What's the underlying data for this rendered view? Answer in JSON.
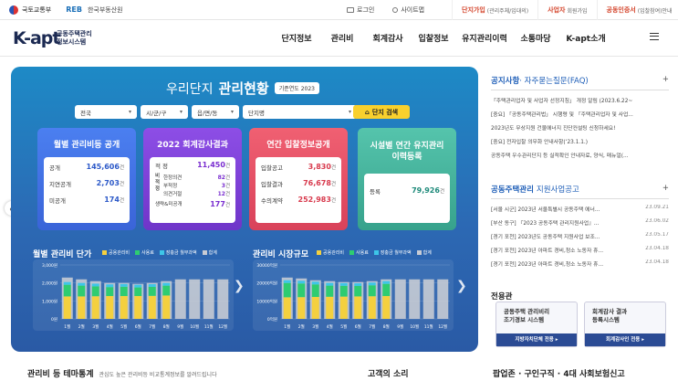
{
  "topbar": {
    "ministry": "국토교통부",
    "reb_logo": "REB",
    "reb_name": "한국부동산원",
    "login": "로그인",
    "sitemap": "사이트맵",
    "join_complex": "단지가입",
    "join_complex_sub": "(관리주체/입대의)",
    "join_business": "사업자",
    "join_business_sub": "회원가입",
    "cert": "공동인증서",
    "cert_sub": "(입찰참여)안내"
  },
  "nav": {
    "logo": "K-apt",
    "logo_sub_1": "공동주택관리",
    "logo_sub_2": "정보시스템",
    "items": [
      "단지정보",
      "관리비",
      "회계감사",
      "입찰정보",
      "유지관리이력",
      "소통마당",
      "K-apt소개"
    ]
  },
  "panel": {
    "title_light": "우리단지",
    "title_bold": "관리현황",
    "year_label": "기준연도 2023",
    "filters": [
      "전국",
      "시/군/구",
      "읍/면/동",
      "단지명"
    ],
    "search_button": "단지 검색",
    "cards": [
      {
        "title": "월별 관리비등 공개",
        "rows": [
          [
            "공개",
            "145,606",
            "건"
          ],
          [
            "지연공개",
            "2,703",
            "건"
          ],
          [
            "미공개",
            "174",
            "건"
          ]
        ]
      },
      {
        "title": "2022 회계감사결과",
        "rows": [
          [
            "적 정",
            "11,450",
            "건"
          ],
          [
            "한정의견",
            "82",
            "건"
          ],
          [
            "부적정",
            "3",
            "건"
          ],
          [
            "의견거절",
            "12",
            "건"
          ],
          [
            "생략&미공개",
            "177",
            "건"
          ]
        ],
        "side_label": "비적정"
      },
      {
        "title": "연간 입찰정보공개",
        "rows": [
          [
            "입찰공고",
            "3,830",
            "건"
          ],
          [
            "입찰결과",
            "76,678",
            "건"
          ],
          [
            "수의계약",
            "252,983",
            "건"
          ]
        ]
      },
      {
        "title": "시설별 연간 유지관리 이력등록",
        "rows": [
          [
            "등록",
            "79,926",
            "건"
          ]
        ]
      }
    ],
    "chart1_title": "월별 관리비 단가",
    "chart2_title": "관리비 시장규모",
    "legend": [
      "공용관리비",
      "사용료",
      "장충금 월부과액",
      "합계"
    ],
    "legend_colors": [
      "#f4d03f",
      "#2ecc71",
      "#3dc6e8",
      "#c7cbd4"
    ]
  },
  "chart_data": [
    {
      "type": "bar",
      "title": "월별 관리비 단가",
      "ylabel": "",
      "categories": [
        "1월",
        "2월",
        "3월",
        "4월",
        "5월",
        "6월",
        "7월",
        "8월",
        "9월",
        "10월",
        "11월",
        "12월"
      ],
      "y_ticks": [
        "3,000원",
        "2,000원",
        "1,000원",
        "0원"
      ],
      "ylim": [
        0,
        3000
      ],
      "series": [
        {
          "name": "공용관리비",
          "values": [
            1250,
            1250,
            1260,
            1270,
            1270,
            1270,
            1280,
            1300,
            0,
            0,
            0,
            0
          ]
        },
        {
          "name": "사용료",
          "values": [
            650,
            600,
            550,
            500,
            520,
            480,
            500,
            550,
            0,
            0,
            0,
            0
          ]
        },
        {
          "name": "장충금 월부과액",
          "values": [
            150,
            150,
            150,
            150,
            150,
            150,
            150,
            150,
            0,
            0,
            0,
            0
          ]
        },
        {
          "name": "합계",
          "values": [
            2300,
            2200,
            2100,
            2000,
            2000,
            1950,
            2000,
            2100,
            2200,
            2200,
            2200,
            2200
          ]
        }
      ]
    },
    {
      "type": "bar",
      "title": "관리비 시장규모",
      "ylabel": "",
      "categories": [
        "1월",
        "2월",
        "3월",
        "4월",
        "5월",
        "6월",
        "7월",
        "8월",
        "9월",
        "10월",
        "11월",
        "12월"
      ],
      "y_ticks": [
        "30000억원",
        "20000억원",
        "10000억원",
        "0억원"
      ],
      "ylim": [
        0,
        30000
      ],
      "series": [
        {
          "name": "공용관리비",
          "values": [
            12000,
            12100,
            12200,
            12300,
            12400,
            12500,
            12600,
            12700,
            0,
            0,
            0,
            0
          ]
        },
        {
          "name": "사용료",
          "values": [
            8000,
            7600,
            7000,
            6200,
            6000,
            5800,
            6100,
            6800,
            0,
            0,
            0,
            0
          ]
        },
        {
          "name": "장충금 월부과액",
          "values": [
            1500,
            1500,
            1500,
            1500,
            1500,
            1500,
            1500,
            1500,
            0,
            0,
            0,
            0
          ]
        },
        {
          "name": "합계",
          "values": [
            23000,
            22500,
            21500,
            21000,
            20500,
            20500,
            21000,
            22000,
            22000,
            22000,
            22000,
            22000
          ]
        }
      ]
    }
  ],
  "notice": {
    "title": "공지사항",
    "title_sub": "· 자주묻는질문(FAQ)",
    "items": [
      [
        "「주택관리업자 및 사업자 선정지침」 개정 알림 (2023.6.22~",
        ""
      ],
      [
        "[중요] 「공동주택관리법」 시행령 및 「주택관리업자 및 사업...",
        ""
      ],
      [
        "2023년도 무상지원 건물에너지 진단컨설팅 신청하세요!",
        ""
      ],
      [
        "[중요] 전자입찰 의무화 안내사항(‘23.1.1.)",
        ""
      ],
      [
        "공동주택 우수관리단지 등 실적확인 안내자료, 양식, 매뉴얼(...",
        ""
      ]
    ]
  },
  "support": {
    "title": "공동주택관리",
    "title_sub": "지원사업공고",
    "items": [
      [
        "[서울 시군] 2023년 서울특별시 공동주택 에너...",
        "23.09.21"
      ],
      [
        "[부산 동구] 『2023 공동주택 관리지원사업』...",
        "23.06.02"
      ],
      [
        "[경기 포천] 2023년도 공동주택 지원사업 보조...",
        "23.05.17"
      ],
      [
        "[경기 포천] 2023년 아파트 경비,청소 노동자 휴...",
        "23.04.18"
      ],
      [
        "[경기 포천] 2023년 아파트 경비,청소 노동자 휴...",
        "23.04.18"
      ]
    ]
  },
  "exclusive": {
    "title": "전용관",
    "box1_line1": "공동주택 관리비리",
    "box1_line2": "조기경보 시스템",
    "box1_foot": "지방자치단체 전용 ▸",
    "box2_line1": "회계감사 결과",
    "box2_line2": "등록시스템",
    "box2_foot": "회계감사인 전용 ▸"
  },
  "bottom": {
    "stats_title": "관리비 등 테마통계",
    "stats_sub": "관심도 높은 관리비등 비교통계정보를 알려드립니다",
    "voice": "고객의 소리",
    "right": "팝업존 · 구인구직 · 4대 사회보험신고"
  }
}
